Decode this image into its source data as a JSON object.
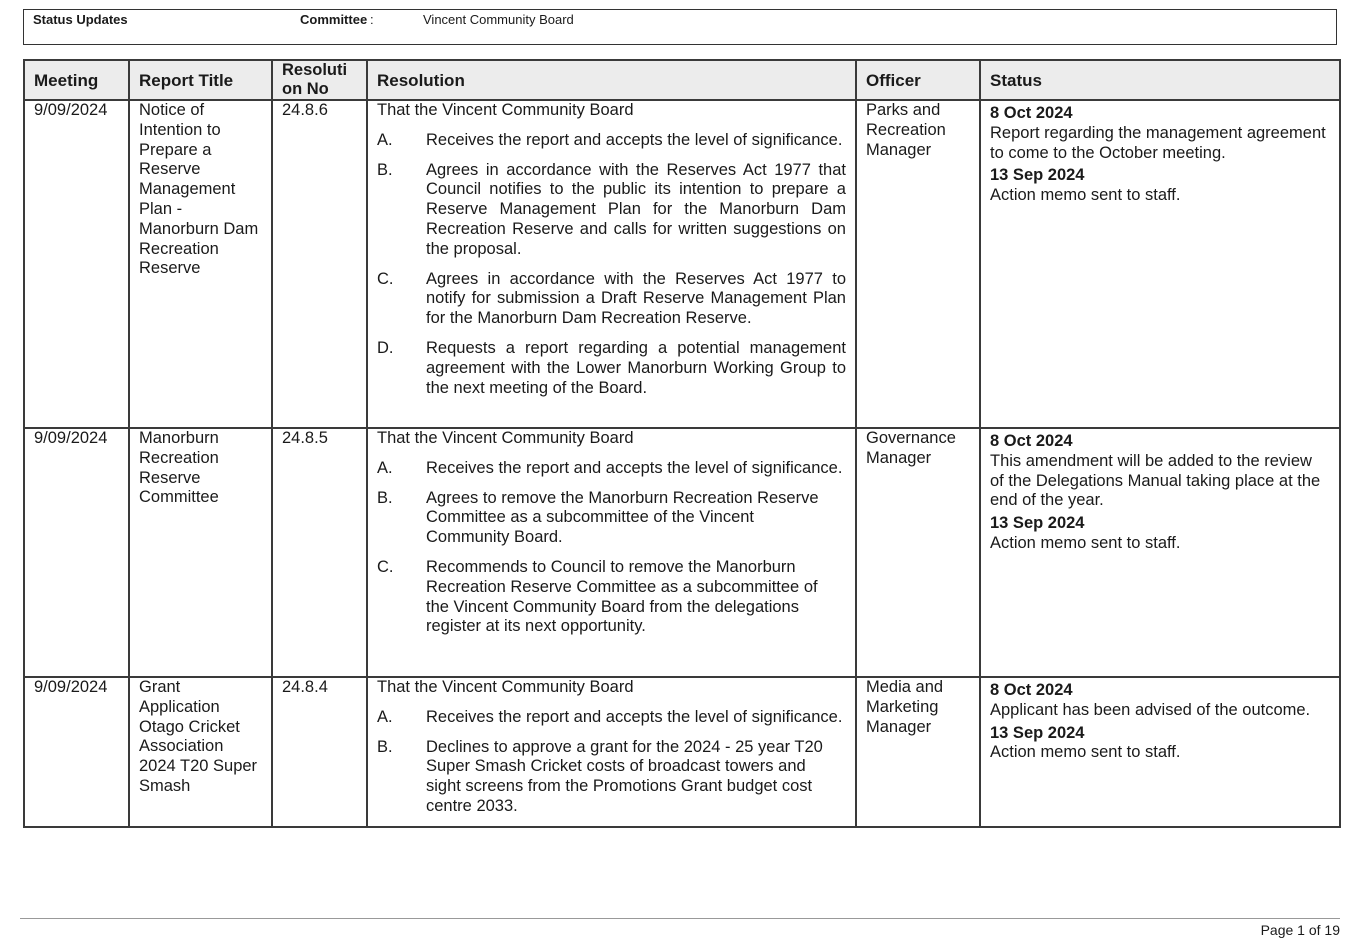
{
  "header": {
    "label_status": "Status Updates",
    "label_committee": "Committee",
    "committee_colon": ":",
    "committee_name": "Vincent Community Board"
  },
  "columns": [
    "Meeting",
    "Report Title",
    "Resoluti on No",
    "Resolution",
    "Officer",
    "Status"
  ],
  "rows": [
    {
      "meeting": "9/09/2024",
      "title": "Notice of Intention to Prepare a Reserve Management Plan - Manorburn Dam Recreation Reserve",
      "res_no": "24.8.6",
      "intro": "That the Vincent Community Board",
      "items": [
        {
          "letter": "A.",
          "text": "Receives the report and accepts the level of significance."
        },
        {
          "letter": "B.",
          "text": "Agrees in accordance with the Reserves Act 1977 that Council notifies to the public its intention to prepare a Reserve Management Plan for the Manorburn Dam Recreation Reserve and calls for written suggestions on the proposal."
        },
        {
          "letter": "C.",
          "text": "Agrees in accordance with the Reserves Act 1977 to notify for submission a Draft Reserve Management Plan for the Manorburn Dam Recreation Reserve."
        },
        {
          "letter": "D.",
          "text": "Requests a report regarding a potential management agreement with the Lower Manorburn Working Group to the next meeting of the Board."
        }
      ],
      "officer": "Parks and Recreation Manager",
      "status": [
        {
          "date": "8 Oct 2024",
          "text": "Report regarding the management agreement to come to the October meeting."
        },
        {
          "date": "13 Sep 2024",
          "text": "Action memo sent to staff."
        }
      ]
    },
    {
      "meeting": "9/09/2024",
      "title": "Manorburn Recreation Reserve Committee",
      "res_no": "24.8.5",
      "intro": "That the Vincent Community Board",
      "items": [
        {
          "letter": "A.",
          "text": "Receives the report and accepts the level of significance."
        },
        {
          "letter": "B.",
          "text": "Agrees to remove the Manorburn Recreation Reserve Committee as a subcommittee of the Vincent Community Board."
        },
        {
          "letter": "C.",
          "text": "Recommends to Council to remove the Manorburn Recreation Reserve Committee as a subcommittee of the Vincent Community Board from the delegations register at its next opportunity."
        }
      ],
      "officer": "Governance Manager",
      "status": [
        {
          "date": "8 Oct 2024",
          "text": "This amendment will be added to the review of the Delegations Manual taking place at the end of the year."
        },
        {
          "date": "13 Sep 2024",
          "text": "Action memo sent to staff."
        }
      ]
    },
    {
      "meeting": "9/09/2024",
      "title": "Grant Application Otago Cricket Association 2024 T20 Super Smash",
      "res_no": "24.8.4",
      "intro": "That the Vincent Community Board",
      "items": [
        {
          "letter": "A.",
          "text": "Receives the report and accepts the level of significance."
        },
        {
          "letter": "B.",
          "text": "Declines to approve a grant for the 2024 - 25 year T20 Super Smash Cricket costs of broadcast towers and sight screens from the Promotions Grant budget cost centre 2033."
        }
      ],
      "officer": "Media and Marketing Manager",
      "status": [
        {
          "date": "8 Oct 2024",
          "text": "Applicant has been advised of the outcome."
        },
        {
          "date": "13 Sep 2024",
          "text": "Action memo sent to staff."
        }
      ]
    }
  ],
  "footer": {
    "page": "Page 1 of 19"
  }
}
